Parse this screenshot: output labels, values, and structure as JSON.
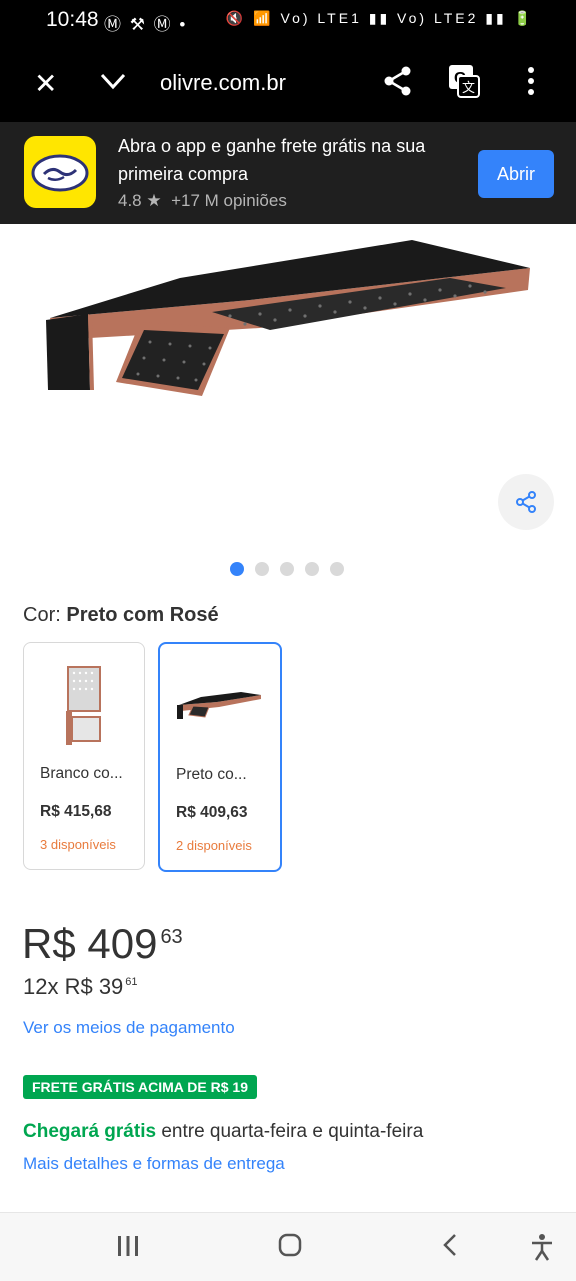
{
  "status_bar": {
    "time": "10:48",
    "left_icons": "Ⓜ ⚒ Ⓜ •",
    "right_icons": "🔇 📶 Vo) LTE1 ▮▮ Vo) LTE2 ▮▮ 🔋"
  },
  "browser": {
    "url": "olivre.com.br",
    "close_icon": "close-icon",
    "expand_icon": "chevron-down-icon",
    "share_icon": "share-icon",
    "translate_icon": "translate-icon",
    "menu_icon": "more-vert-icon"
  },
  "app_banner": {
    "title": "Abra o app e ganhe frete grátis na sua primeira compra",
    "rating": "4.8 ★",
    "reviews": "+17 M opiniões",
    "open_button": "Abrir"
  },
  "gallery": {
    "total_images": 5,
    "active_index": 0
  },
  "color": {
    "label": "Cor:",
    "value": "Preto com Rosé"
  },
  "variants": [
    {
      "name": "Branco co...",
      "price": "R$ 415,68",
      "stock": "3 disponíveis",
      "selected": false
    },
    {
      "name": "Preto co...",
      "price": "R$ 409,63",
      "stock": "2 disponíveis",
      "selected": true
    }
  ],
  "price": {
    "integer": "R$ 409",
    "cents": "63"
  },
  "installments": {
    "text": "12x R$ 39",
    "cents": "61"
  },
  "payment_link": "Ver os meios de pagamento",
  "shipping": {
    "badge": "FRETE GRÁTIS ACIMA DE R$ 19",
    "arrival_highlight": "Chegará grátis",
    "arrival_rest": "entre quarta-feira e quinta-feira",
    "details_link": "Mais detalhes e formas de entrega"
  },
  "colors": {
    "primary_blue": "#3483fa",
    "green": "#00a650",
    "brand_yellow": "#ffe600",
    "stock_orange": "#e87b3d"
  }
}
